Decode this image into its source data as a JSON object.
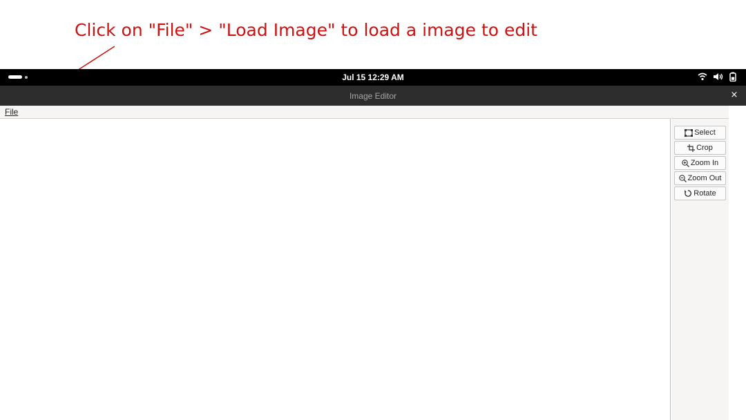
{
  "annotation": {
    "text": "Click on \"File\" > \"Load Image\" to load a image to edit"
  },
  "topbar": {
    "clock": "Jul 15  12:29 AM",
    "tray_icons": [
      "wifi-icon",
      "volume-icon",
      "battery-icon"
    ]
  },
  "window": {
    "title": "Image Editor",
    "close_label": "×"
  },
  "menubar": {
    "file_label": "File"
  },
  "tools": [
    {
      "label": "Select",
      "icon": "select-icon"
    },
    {
      "label": "Crop",
      "icon": "crop-icon"
    },
    {
      "label": "Zoom In",
      "icon": "zoom-in-icon"
    },
    {
      "label": "Zoom Out",
      "icon": "zoom-out-icon"
    },
    {
      "label": "Rotate",
      "icon": "rotate-icon"
    }
  ],
  "colors": {
    "annotation": "#cc1111",
    "topbar_bg": "#000000",
    "titlebar_bg": "#2d2d2d",
    "panel_bg": "#f6f5f4"
  }
}
